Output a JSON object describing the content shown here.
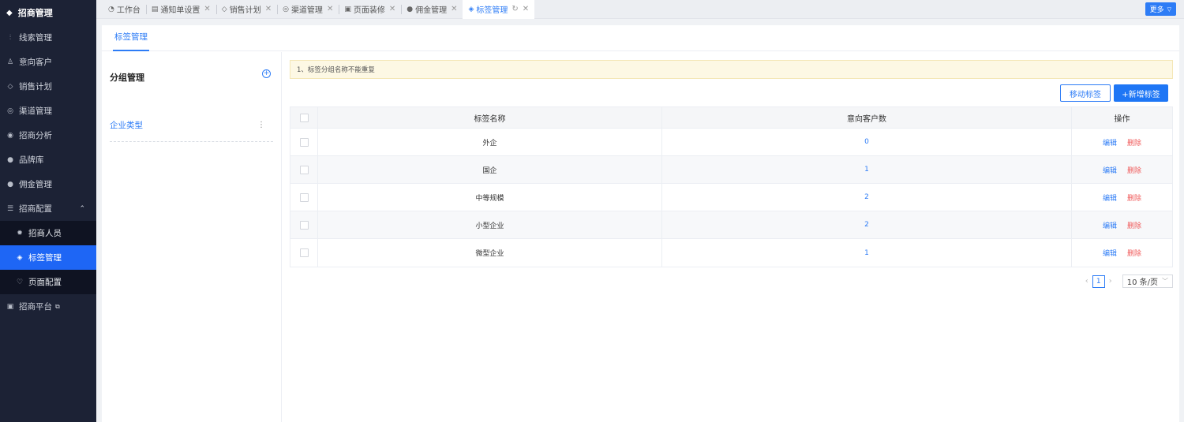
{
  "sidebar": {
    "header": {
      "icon": "shield-icon",
      "label": "招商管理"
    },
    "items": [
      {
        "label": "线索管理",
        "icon": "branch-icon"
      },
      {
        "label": "意向客户",
        "icon": "person-icon"
      },
      {
        "label": "销售计划",
        "icon": "tag-icon"
      },
      {
        "label": "渠道管理",
        "icon": "target-icon"
      },
      {
        "label": "招商分析",
        "icon": "chart-icon"
      },
      {
        "label": "品牌库",
        "icon": "brand-icon"
      },
      {
        "label": "佣金管理",
        "icon": "coin-icon"
      },
      {
        "label": "招商配置",
        "icon": "config-icon"
      }
    ],
    "sub_items": [
      {
        "label": "招商人员",
        "icon": "gear-icon"
      },
      {
        "label": "标签管理",
        "icon": "tag-icon"
      },
      {
        "label": "页面配置",
        "icon": "page-icon"
      }
    ],
    "platform": {
      "label": "招商平台",
      "icon": "platform-icon"
    }
  },
  "tabs": [
    {
      "label": "工作台",
      "icon": "dashboard-icon"
    },
    {
      "label": "通知单设置",
      "icon": "notice-icon"
    },
    {
      "label": "销售计划",
      "icon": "tag-icon"
    },
    {
      "label": "渠道管理",
      "icon": "target-icon"
    },
    {
      "label": "页面装修",
      "icon": "page-icon"
    },
    {
      "label": "佣金管理",
      "icon": "coin-icon"
    },
    {
      "label": "标签管理",
      "icon": "tag-icon"
    }
  ],
  "more_label": "更多",
  "page_tab": "标签管理",
  "group": {
    "title": "分组管理",
    "items": [
      "企业类型"
    ]
  },
  "notice": "1、标签分组名称不能重复",
  "buttons": {
    "move": "移动标签",
    "add": "+新增标签"
  },
  "table": {
    "headers": [
      "标签名称",
      "意向客户数",
      "操作"
    ],
    "rows": [
      {
        "name": "外企",
        "count": "0"
      },
      {
        "name": "国企",
        "count": "1"
      },
      {
        "name": "中等规模",
        "count": "2"
      },
      {
        "name": "小型企业",
        "count": "2"
      },
      {
        "name": "微型企业",
        "count": "1"
      }
    ],
    "edit_label": "编辑",
    "delete_label": "删除"
  },
  "pagination": {
    "current": "1",
    "page_size": "10 条/页"
  },
  "colors": {
    "accent": "#2d7cf6",
    "danger": "#f05a5a",
    "sidebar": "#1c2235",
    "active": "#1e66f5"
  }
}
